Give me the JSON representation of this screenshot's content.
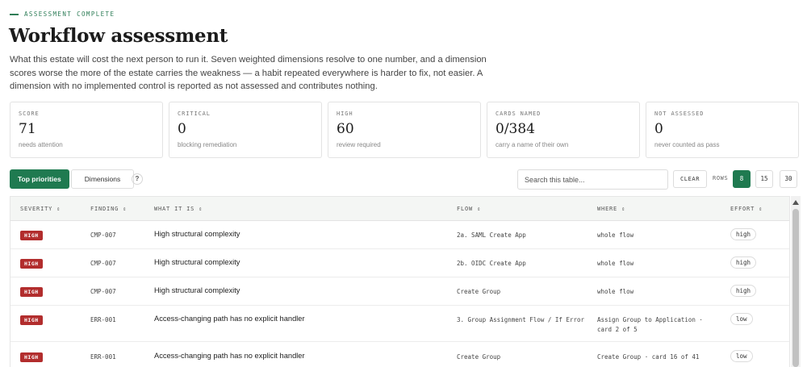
{
  "header": {
    "eyebrow": "ASSESSMENT COMPLETE",
    "title": "Workflow assessment",
    "intro": "What this estate will cost the next person to run it. Seven weighted dimensions resolve to one number, and a dimension scores worse the more of the estate carries the weakness — a habit repeated everywhere is harder to fix, not easier. A dimension with no implemented control is reported as not assessed and contributes nothing."
  },
  "cards": [
    {
      "label": "SCORE",
      "value": "71",
      "sub": "needs attention"
    },
    {
      "label": "CRITICAL",
      "value": "0",
      "sub": "blocking remediation"
    },
    {
      "label": "HIGH",
      "value": "60",
      "sub": "review required"
    },
    {
      "label": "CARDS NAMED",
      "value": "0/384",
      "sub": "carry a name of their own"
    },
    {
      "label": "NOT ASSESSED",
      "value": "0",
      "sub": "never counted as pass"
    }
  ],
  "controls": {
    "tab_primary": "Top priorities",
    "tab_secondary": "Dimensions",
    "help": "?",
    "search_placeholder": "Search this table...",
    "clear": "CLEAR",
    "rows_label": "ROWS",
    "rows_options": [
      "8",
      "15",
      "30"
    ],
    "rows_selected": "8"
  },
  "table": {
    "headers": [
      "SEVERITY ⇕",
      "FINDING ⇕",
      "WHAT IT IS ⇕",
      "FLOW ⇕",
      "WHERE ⇕",
      "EFFORT ⇕"
    ],
    "rows": [
      {
        "severity": "HIGH",
        "finding": "CMP-007",
        "what": "High structural complexity",
        "flow": "2a. SAML Create App",
        "where": "whole flow",
        "where2": "",
        "effort": "high"
      },
      {
        "severity": "HIGH",
        "finding": "CMP-007",
        "what": "High structural complexity",
        "flow": "2b. OIDC Create App",
        "where": "whole flow",
        "where2": "",
        "effort": "high"
      },
      {
        "severity": "HIGH",
        "finding": "CMP-007",
        "what": "High structural complexity",
        "flow": "Create Group",
        "where": "whole flow",
        "where2": "",
        "effort": "high"
      },
      {
        "severity": "HIGH",
        "finding": "ERR-001",
        "what": "Access-changing path has no explicit handler",
        "flow": "3. Group Assignment Flow / If Error",
        "where": "Assign Group to Application ·",
        "where2": "card 2 of 5",
        "effort": "low"
      },
      {
        "severity": "HIGH",
        "finding": "ERR-001",
        "what": "Access-changing path has no explicit handler",
        "flow": "Create Group",
        "where": "Create Group · card 16 of 41",
        "where2": "",
        "effort": "low"
      }
    ]
  },
  "colors": {
    "accent": "#1f7a50",
    "severity_high": "#b22d2d"
  },
  "icons": {
    "help": "question-mark-icon",
    "scroll_up": "chevron-up-icon"
  }
}
